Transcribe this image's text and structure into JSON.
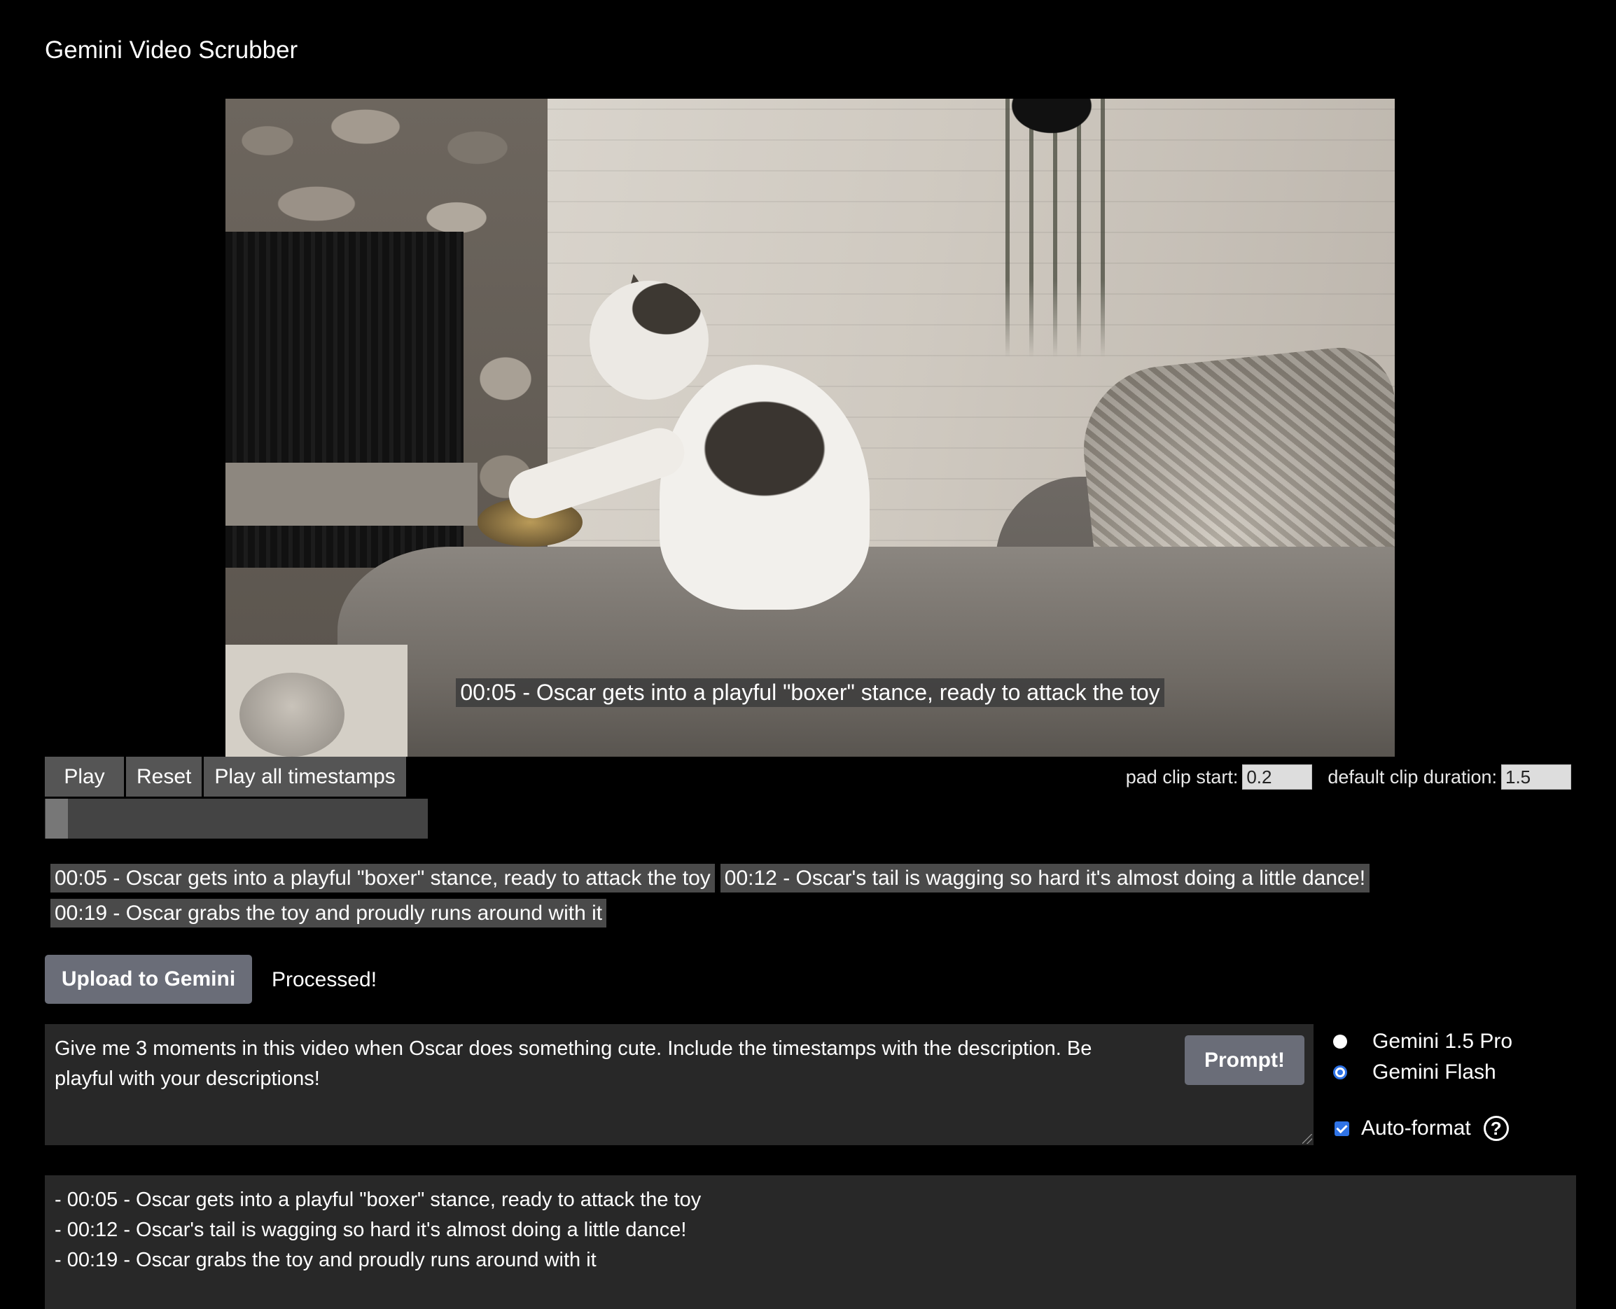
{
  "app": {
    "title": "Gemini Video Scrubber"
  },
  "video": {
    "caption": "00:05 - Oscar gets into a playful \"boxer\" stance, ready to attack the toy",
    "progress_fraction": 0.06
  },
  "controls": {
    "play_label": "Play",
    "reset_label": "Reset",
    "play_all_label": "Play all timestamps"
  },
  "settings": {
    "pad_label": "pad clip start:",
    "pad_value": "0.2",
    "duration_label": "default clip duration:",
    "duration_value": "1.5"
  },
  "timestamps": [
    "00:05 - Oscar gets into a playful \"boxer\" stance, ready to attack the toy",
    "00:12 - Oscar's tail is wagging so hard it's almost doing a little dance!",
    "00:19 - Oscar grabs the toy and proudly runs around with it"
  ],
  "upload": {
    "label": "Upload to Gemini",
    "status": "Processed!"
  },
  "prompt": {
    "text": "Give me 3 moments in this video when Oscar does something cute. Include the timestamps with the description. Be playful with your descriptions!",
    "button_label": "Prompt!"
  },
  "models": {
    "options": [
      "Gemini 1.5 Pro",
      "Gemini Flash"
    ],
    "selected": "Gemini Flash"
  },
  "autoformat": {
    "label": "Auto-format",
    "checked": true,
    "help_icon": "question-circle-icon"
  },
  "output": {
    "lines": [
      "- 00:05 - Oscar gets into a playful \"boxer\" stance, ready to attack the toy",
      "- 00:12 - Oscar's tail is wagging so hard it's almost doing a little dance!",
      "- 00:19 - Oscar grabs the toy and proudly runs around with it"
    ]
  },
  "colors": {
    "accent": "#2f73e6",
    "button": "#6a6d78",
    "chip": "#4a4a4a",
    "panel": "#282828"
  }
}
